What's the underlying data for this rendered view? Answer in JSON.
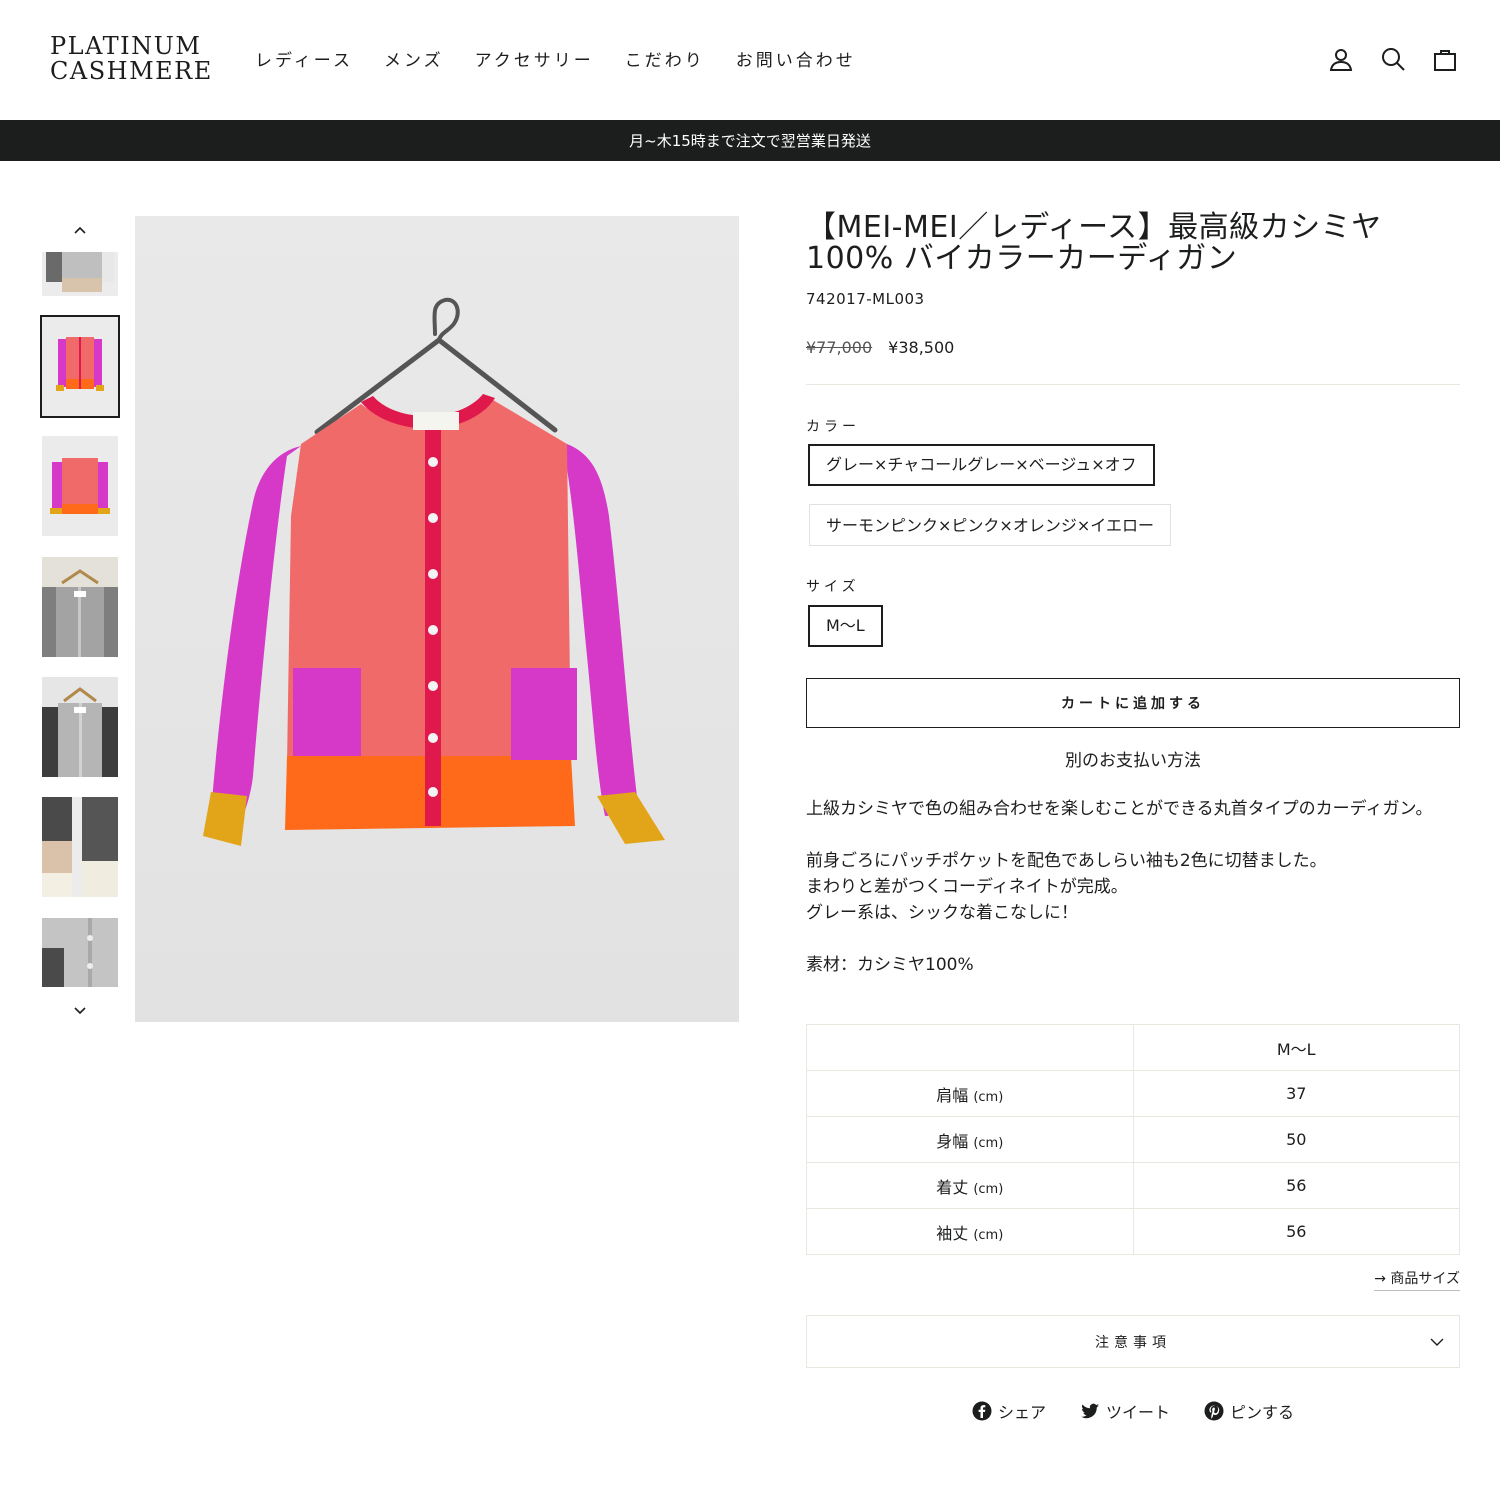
{
  "brand": {
    "line1": "PLATINUM",
    "line2": "CASHMERE"
  },
  "nav": [
    "レディース",
    "メンズ",
    "アクセサリー",
    "こだわり",
    "お問い合わせ"
  ],
  "announcement": "月~木15時まで注文で翌営業日発送",
  "product": {
    "title_line1": "【MEI-MEI／レディース】最高級カシミヤ",
    "title_line2": "100% バイカラーカーディガン",
    "sku": "742017-ML003",
    "compare_price": "¥77,000",
    "price": "¥38,500",
    "color_label": "カラー",
    "colors": [
      "グレー×チャコールグレー×ベージュ×オフ",
      "サーモンピンク×ピンク×オレンジ×イエロー"
    ],
    "size_label": "サイズ",
    "sizes": [
      "M〜L"
    ],
    "add_to_cart": "カートに追加する",
    "alt_payment": "別のお支払い方法",
    "description": [
      "上級カシミヤで色の組み合わせを楽しむことができる丸首タイプのカーディガン。",
      "",
      "前身ごろにパッチポケットを配色であしらい袖も2色に切替ました。",
      "まわりと差がつくコーディネイトが完成。",
      "グレー系は、シックな着こなしに！",
      "",
      "素材：カシミヤ100%"
    ],
    "size_table": {
      "header": [
        "",
        "M〜L"
      ],
      "rows": [
        {
          "label": "肩幅",
          "unit": "(cm)",
          "value": "37"
        },
        {
          "label": "身幅",
          "unit": "(cm)",
          "value": "50"
        },
        {
          "label": "着丈",
          "unit": "(cm)",
          "value": "56"
        },
        {
          "label": "袖丈",
          "unit": "(cm)",
          "value": "56"
        }
      ]
    },
    "size_link": "→ 商品サイズ",
    "notes_label": "注意事項",
    "share": [
      "シェア",
      "ツイート",
      "ピンする"
    ]
  },
  "colors": {
    "text": "#1c1d1d",
    "announce_bg": "#1c1d1d",
    "salmon": "#f06a6a",
    "magenta": "#d638c8",
    "orange": "#ff6a1a",
    "yellow": "#e2a418",
    "red": "#e0194d"
  }
}
